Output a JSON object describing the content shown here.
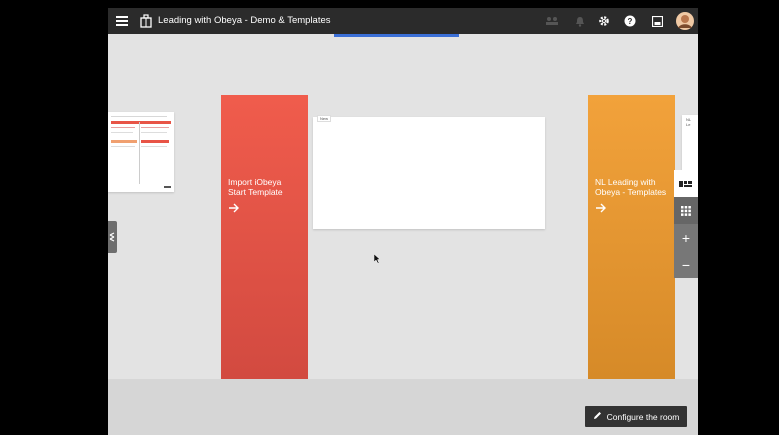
{
  "app": {
    "title": "Leading with Obeya - Demo & Templates",
    "accent_color": "#3b6fd6"
  },
  "topbar": {
    "menu_icon": "hamburger-menu-icon",
    "logo_icon": "obeya-building-icon",
    "right_icons": [
      "team-icon",
      "notification-bell-icon",
      "gear-icon",
      "help-icon",
      "save-icon",
      "user-avatar"
    ]
  },
  "columns": {
    "import": {
      "label": "Import iObeya Start Template",
      "color": "#e85446"
    },
    "nl": {
      "label": "NL Leading with Obeya - Templates",
      "color": "#e6972f"
    }
  },
  "boards": {
    "new_tag": "New",
    "right_partial_tag": "NL Le"
  },
  "tools": {
    "minimap_icon": "minimap-icon",
    "grid_icon": "grid-icon",
    "zoom_in": "+",
    "zoom_out": "−"
  },
  "configure_button": {
    "label": "Configure the room",
    "icon": "pencil-icon"
  }
}
